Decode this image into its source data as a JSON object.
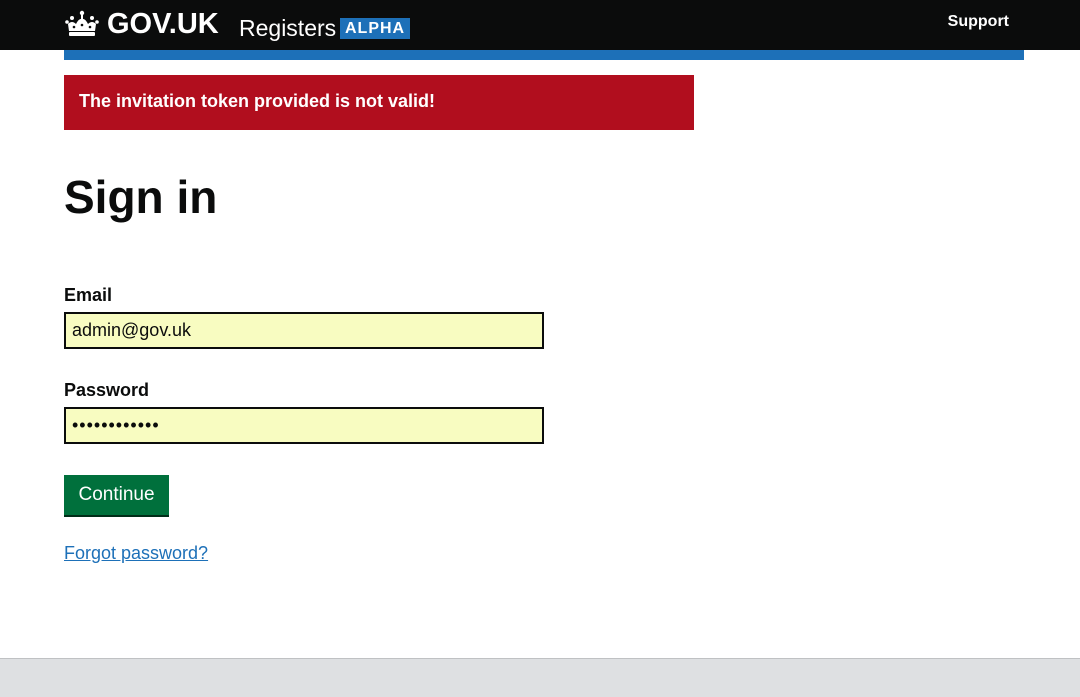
{
  "header": {
    "brand": "GOV.UK",
    "service_name": "Registers",
    "phase": "ALPHA",
    "support_link": "Support"
  },
  "error": {
    "message": "The invitation token provided is not valid!"
  },
  "page": {
    "title": "Sign in"
  },
  "form": {
    "email_label": "Email",
    "email_value": "admin@gov.uk",
    "password_label": "Password",
    "password_value": "••••••••••••",
    "submit_label": "Continue",
    "forgot_link": "Forgot password?"
  },
  "colors": {
    "header_bg": "#0b0c0c",
    "brand_blue": "#1d70b8",
    "error_red": "#b10e1e",
    "input_bg": "#f8fcc1",
    "button_green": "#00703c",
    "footer_bg": "#dee0e2"
  },
  "icons": {
    "logo": "crown-icon"
  }
}
